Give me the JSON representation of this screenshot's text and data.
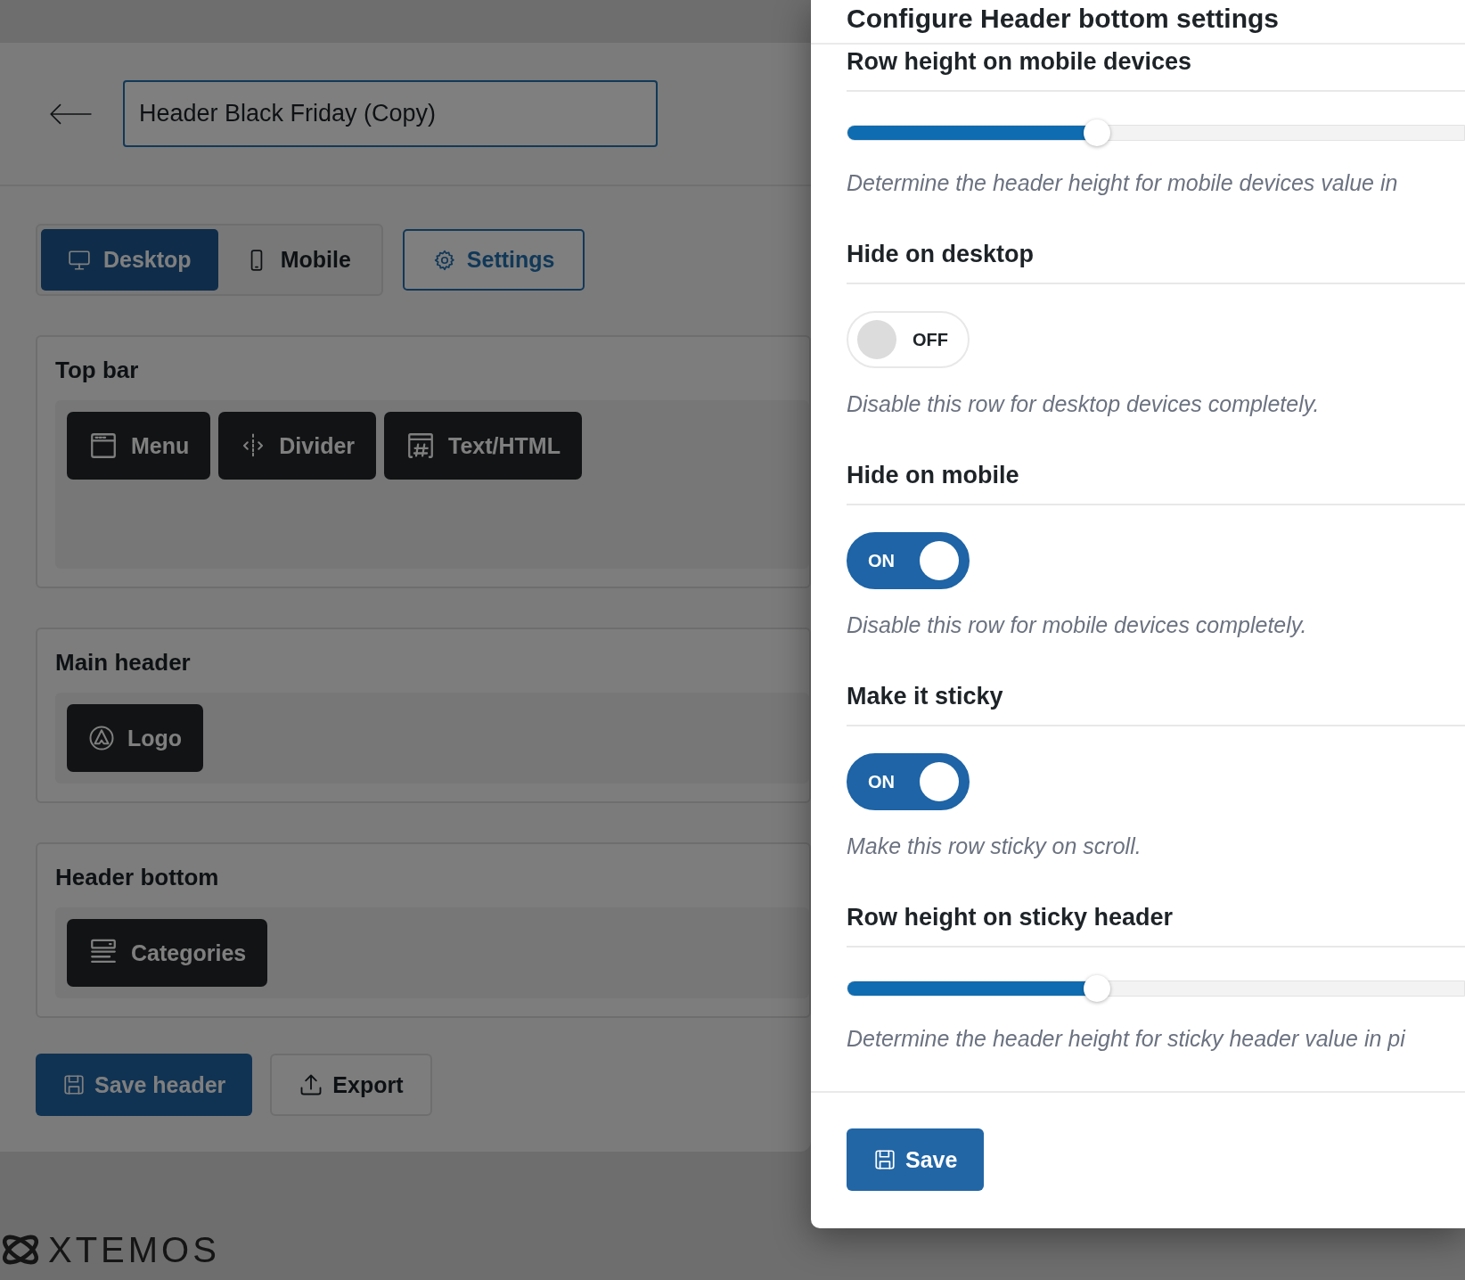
{
  "editor": {
    "header_name": "Header Black Friday (Copy)",
    "view_tabs": [
      {
        "label": "Desktop",
        "selected": true
      },
      {
        "label": "Mobile",
        "selected": false
      }
    ],
    "settings_button": "Settings",
    "rows": [
      {
        "title": "Top bar",
        "elements": [
          {
            "kind": "menu",
            "label": "Menu"
          },
          {
            "kind": "divider",
            "label": "Divider"
          },
          {
            "kind": "html",
            "label": "Text/HTML"
          }
        ]
      },
      {
        "title": "Main header",
        "elements": [
          {
            "kind": "logo",
            "label": "Logo"
          }
        ]
      },
      {
        "title": "Header bottom",
        "elements": [
          {
            "kind": "categories",
            "label": "Categories"
          }
        ]
      }
    ],
    "actions": [
      {
        "kind": "save",
        "label": "Save header"
      },
      {
        "kind": "export",
        "label": "Export"
      }
    ],
    "brand": "XTEMOS"
  },
  "dialog": {
    "title": "Configure Header bottom settings",
    "settings": [
      {
        "kind": "slider",
        "label": "Row height on mobile devices",
        "level": 0.405,
        "description": "Determine the header height for mobile devices value in"
      },
      {
        "kind": "toggle",
        "label": "Hide on desktop",
        "on": false,
        "state_label": "OFF",
        "description": "Disable this row for desktop devices completely."
      },
      {
        "kind": "toggle",
        "label": "Hide on mobile",
        "on": true,
        "state_label": "ON",
        "description": "Disable this row for mobile devices completely."
      },
      {
        "kind": "toggle",
        "label": "Make it sticky",
        "on": true,
        "state_label": "ON",
        "description": "Make this row sticky on scroll."
      },
      {
        "kind": "slider",
        "label": "Row height on sticky header",
        "level": 0.405,
        "description": "Determine the header height for sticky header value in pi"
      }
    ],
    "save_button": "Save"
  }
}
